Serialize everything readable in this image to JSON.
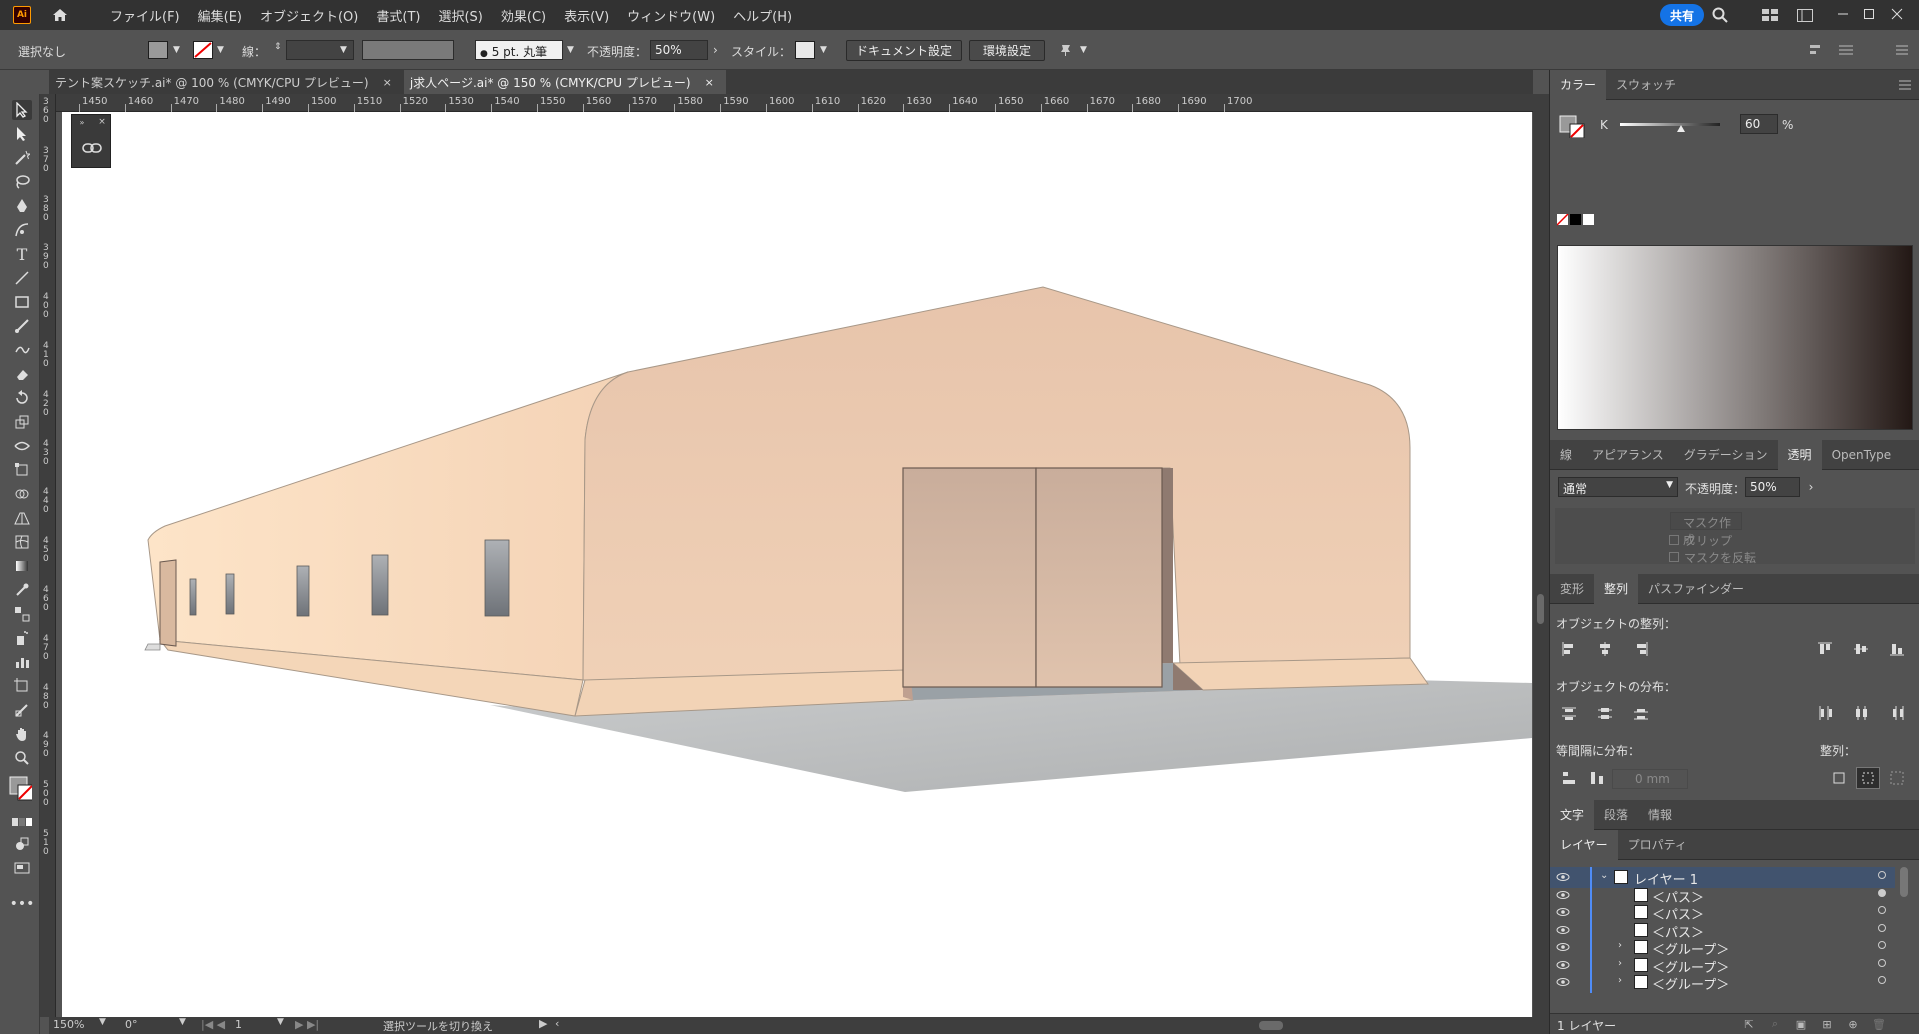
{
  "menubar": {
    "app_logo": "Ai",
    "items": [
      "ファイル(F)",
      "編集(E)",
      "オブジェクト(O)",
      "書式(T)",
      "選択(S)",
      "効果(C)",
      "表示(V)",
      "ウィンドウ(W)",
      "ヘルプ(H)"
    ],
    "share_label": "共有"
  },
  "control_bar": {
    "selection_label": "選択なし",
    "stroke_label": "線：",
    "brush_value": "5 pt. 丸筆",
    "opacity_label": "不透明度：",
    "opacity_value": "50%",
    "style_label": "スタイル：",
    "doc_setup_button": "ドキュメント設定",
    "preferences_button": "環境設定"
  },
  "tabs": [
    {
      "label": "テント案スケッチ.ai* @ 100 % (CMYK/CPU プレビュー)",
      "close": "×"
    },
    {
      "label": "j求人ページ.ai* @ 150 % (CMYK/CPU プレビュー)",
      "close": "×"
    }
  ],
  "ruler": {
    "top_ticks": [
      "1450",
      "1460",
      "1470",
      "1480",
      "1490",
      "1500",
      "1510",
      "1520",
      "1530",
      "1540",
      "1550",
      "1560",
      "1570",
      "1580",
      "1590",
      "1600",
      "1610",
      "1620",
      "1630",
      "1640",
      "1650",
      "1660",
      "1670",
      "1680",
      "1690",
      "1700"
    ],
    "left_ticks": [
      "360",
      "370",
      "380",
      "390",
      "400",
      "410",
      "420",
      "430",
      "440",
      "450",
      "460",
      "470",
      "480",
      "490",
      "500",
      "510"
    ]
  },
  "status_bar": {
    "zoom": "150%",
    "rotation": "0°",
    "artboard": "1",
    "hint": "選択ツールを切り換え"
  },
  "color_panel": {
    "tabs": [
      "カラー",
      "スウォッチ"
    ],
    "channel": "K",
    "value": "60",
    "unit": "%",
    "gray_color": "#999999"
  },
  "transparency_panel": {
    "tabs": [
      "線",
      "アピアランス",
      "グラデーション",
      "透明",
      "OpenType"
    ],
    "blend_mode": "通常",
    "opacity_label": "不透明度：",
    "opacity_value": "50%",
    "make_mask": "マスク作成",
    "clip": "クリップ",
    "invert_mask": "マスクを反転"
  },
  "align_panel": {
    "tabs": [
      "変形",
      "整列",
      "パスファインダー"
    ],
    "align_objects": "オブジェクトの整列：",
    "distribute_objects": "オブジェクトの分布：",
    "distribute_spacing": "等間隔に分布：",
    "align_to": "整列：",
    "spacing_value": "0 mm"
  },
  "type_panel": {
    "tabs": [
      "文字",
      "段落",
      "情報"
    ]
  },
  "layers_panel": {
    "tabs": [
      "レイヤー",
      "プロパティ"
    ],
    "rows": [
      {
        "name": "レイヤー 1",
        "expanded": true
      },
      {
        "name": "＜パス＞"
      },
      {
        "name": "＜パス＞"
      },
      {
        "name": "＜パス＞"
      },
      {
        "name": "＜グループ＞"
      },
      {
        "name": "＜グループ＞"
      },
      {
        "name": "＜グループ＞"
      }
    ],
    "footer": "1 レイヤー"
  }
}
